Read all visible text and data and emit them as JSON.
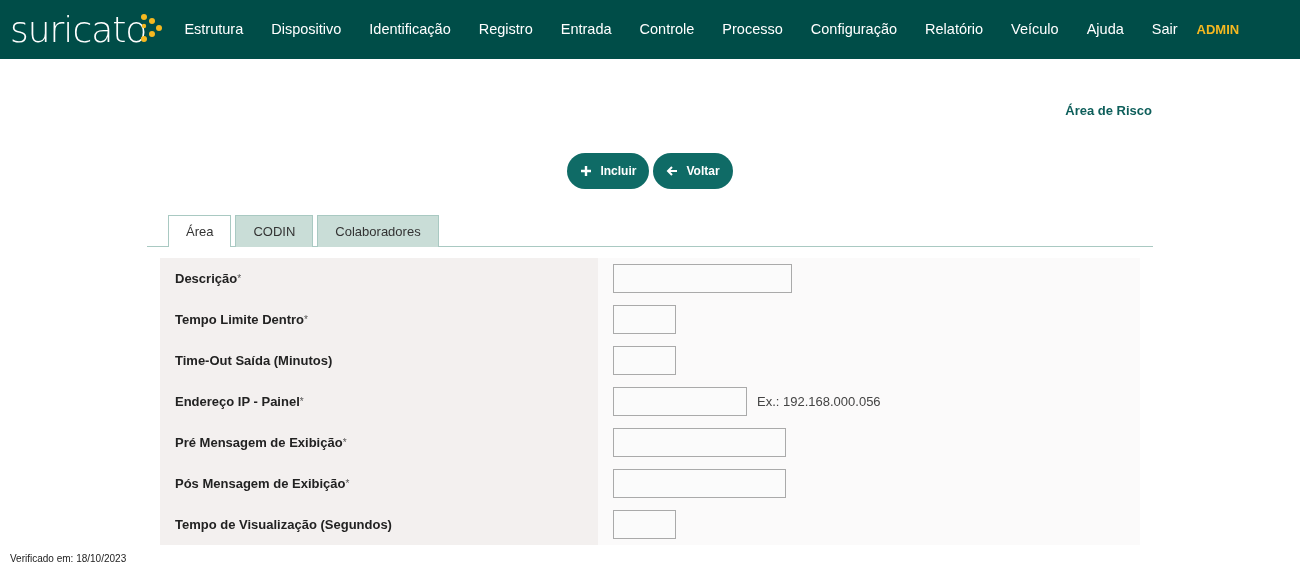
{
  "brand": "suricato",
  "nav": [
    {
      "label": "Estrutura",
      "kind": "link"
    },
    {
      "label": "Dispositivo",
      "kind": "link"
    },
    {
      "label": "Identificação",
      "kind": "link"
    },
    {
      "label": "Registro",
      "kind": "link"
    },
    {
      "label": "Entrada",
      "kind": "link"
    },
    {
      "label": "Controle",
      "kind": "link"
    },
    {
      "label": "Processo",
      "kind": "link"
    },
    {
      "label": "Configuração",
      "kind": "link"
    },
    {
      "label": "Relatório",
      "kind": "link"
    },
    {
      "label": "Veículo",
      "kind": "link"
    },
    {
      "label": "Ajuda",
      "kind": "link"
    },
    {
      "label": "Sair",
      "kind": "link"
    },
    {
      "label": "ADMIN",
      "kind": "user"
    }
  ],
  "page_title": "Área de Risco",
  "buttons": [
    {
      "label": "Incluir",
      "kind": "add"
    },
    {
      "label": "Voltar",
      "kind": "back"
    }
  ],
  "tabs": [
    {
      "label": "Área",
      "selected": true
    },
    {
      "label": "CODIN",
      "selected": false
    },
    {
      "label": "Colaboradores",
      "selected": false
    }
  ],
  "fields": [
    {
      "label": "Descrição",
      "required_mark": "*",
      "kind": "long"
    },
    {
      "label": "Tempo Limite Dentro",
      "required_mark": "*",
      "kind": "short"
    },
    {
      "label": "Time-Out Saída (Minutos)",
      "kind": "short"
    },
    {
      "label": "Endereço IP - Painel",
      "required_mark": "*",
      "kind": "ip",
      "hint": "Ex.: 192.168.000.056"
    },
    {
      "label": "Pré Mensagem de Exibição",
      "required_mark": "*",
      "kind": "medium"
    },
    {
      "label": "Pós Mensagem de Exibição",
      "required_mark": "*",
      "kind": "medium"
    },
    {
      "label": "Tempo de Visualização (Segundos)",
      "kind": "short"
    }
  ],
  "footer": "Verificado em: 18/10/2023"
}
